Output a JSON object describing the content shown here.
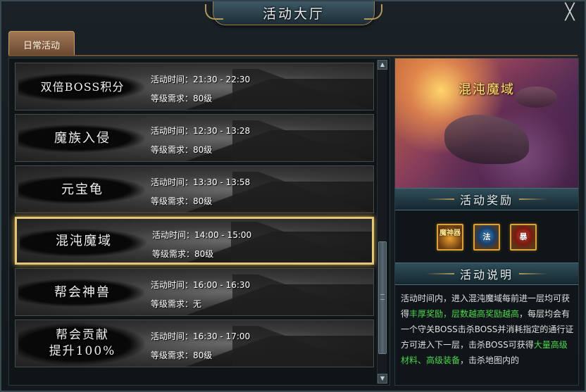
{
  "window": {
    "title": "活动大厅",
    "close_label": "╳"
  },
  "tabs": [
    {
      "label": "日常活动",
      "active": true
    }
  ],
  "labels": {
    "time_prefix": "活动时间：",
    "level_prefix": "等级需求："
  },
  "activities": [
    {
      "name": "双倍BOSS积分",
      "time": "21:30 - 22:30",
      "level": "80级",
      "selected": false
    },
    {
      "name": "魔族入侵",
      "time": "12:30 - 13:28",
      "level": "80级",
      "selected": false
    },
    {
      "name": "元宝龟",
      "time": "13:30 - 13:58",
      "level": "80级",
      "selected": false
    },
    {
      "name": "混沌魔域",
      "time": "14:00 - 15:00",
      "level": "80级",
      "selected": true
    },
    {
      "name": "帮会神兽",
      "time": "16:00 - 16:30",
      "level": "无",
      "selected": false
    },
    {
      "name": "帮会贡献\n提升100%",
      "time": "16:30 - 17:00",
      "level": "80级",
      "selected": false
    }
  ],
  "scrollbar": {
    "up_arrow": "▲",
    "down_arrow": "▼"
  },
  "detail": {
    "banner_title": "混沌魔域",
    "rewards_header": "活动奖励",
    "rewards": [
      {
        "icon": "mystic-box-icon",
        "text": "魔神器"
      },
      {
        "icon": "blue-orb-icon",
        "text": "法"
      },
      {
        "icon": "red-orb-icon",
        "text": "暴"
      }
    ],
    "description_header": "活动说明",
    "description": {
      "p1": "活动时间内，进入混沌魔域每前进一层均可获得",
      "h1": "丰厚奖励，层数越高奖励越高",
      "p2": "，每层均会有一个守关BOSS击杀BOSS并消耗指定的通行证方可进入下一层，击杀BOSS可获得",
      "h2": "大量高级材料、高级装备",
      "p3": "，击杀地图内的"
    }
  },
  "colors": {
    "highlight_green": "#4fd64f",
    "selected_border": "#e3c678",
    "tab_bg": "#8a6446",
    "banner_title": "#ffe27a"
  }
}
